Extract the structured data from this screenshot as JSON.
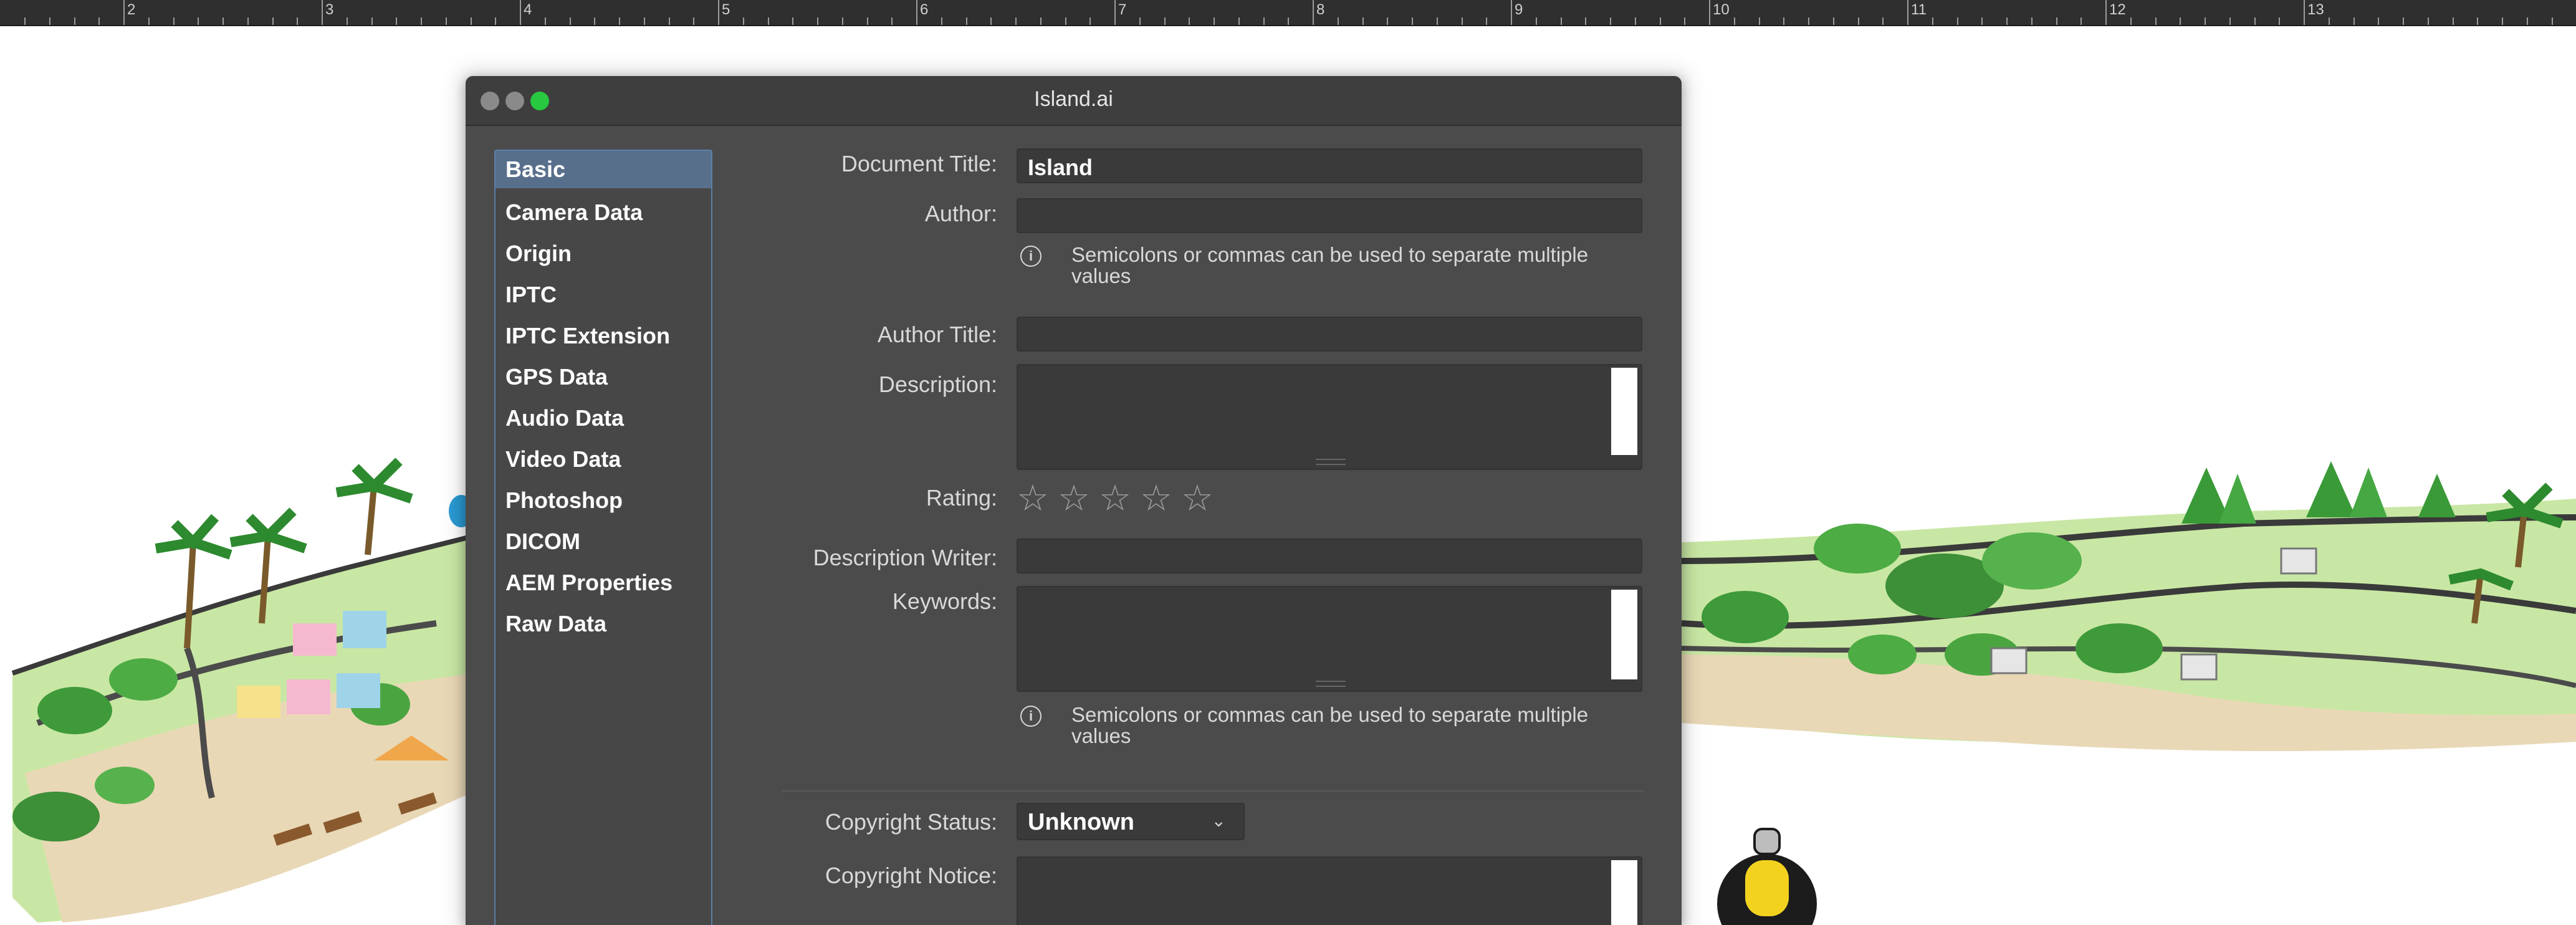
{
  "ruler": {
    "numbers": [
      "2",
      "3",
      "4",
      "5",
      "6",
      "7",
      "8",
      "9",
      "10",
      "11",
      "12",
      "13"
    ]
  },
  "window": {
    "title": "Island.ai",
    "lights": {
      "close": "#8a8a8a",
      "minimize": "#8a8a8a",
      "zoom": "#28c840"
    }
  },
  "sidebar": {
    "items": [
      {
        "label": "Basic",
        "selected": true
      },
      {
        "label": "Camera Data"
      },
      {
        "label": "Origin"
      },
      {
        "label": "IPTC"
      },
      {
        "label": "IPTC Extension"
      },
      {
        "label": "GPS Data"
      },
      {
        "label": "Audio Data"
      },
      {
        "label": "Video Data"
      },
      {
        "label": "Photoshop"
      },
      {
        "label": "DICOM"
      },
      {
        "label": "AEM Properties"
      },
      {
        "label": "Raw Data"
      }
    ]
  },
  "form": {
    "document_title": {
      "label": "Document Title:",
      "value": "Island"
    },
    "author": {
      "label": "Author:",
      "value": ""
    },
    "author_hint": {
      "icon": "info-icon",
      "text": "Semicolons or commas can be used to separate multiple values"
    },
    "author_title": {
      "label": "Author Title:",
      "value": ""
    },
    "description": {
      "label": "Description:",
      "value": ""
    },
    "rating": {
      "label": "Rating:",
      "value": 0,
      "max": 5
    },
    "description_writer": {
      "label": "Description Writer:",
      "value": ""
    },
    "keywords": {
      "label": "Keywords:",
      "value": ""
    },
    "keywords_hint": {
      "icon": "info-icon",
      "text": "Semicolons or commas can be used to separate multiple values"
    },
    "copyright_status": {
      "label": "Copyright Status:",
      "value": "Unknown"
    },
    "copyright_notice": {
      "label": "Copyright Notice:",
      "value": ""
    }
  }
}
